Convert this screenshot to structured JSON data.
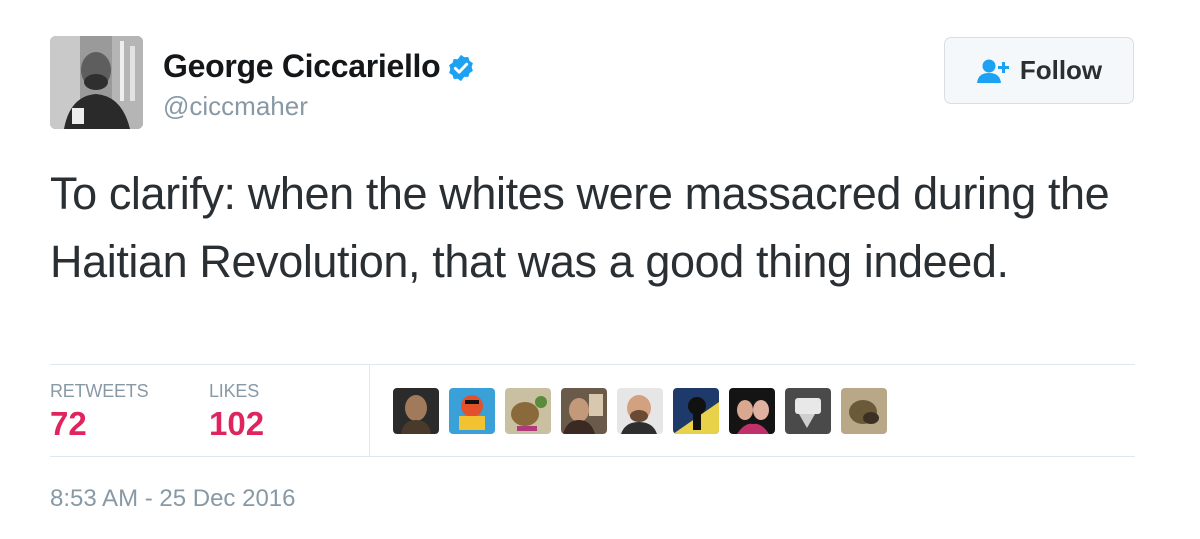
{
  "author": {
    "name": "George Ciccariello",
    "handle": "@ciccmaher",
    "verified": true
  },
  "follow_button": {
    "label": "Follow",
    "icon": "follow-person-plus-icon"
  },
  "tweet": {
    "text": "To clarify: when the whites were massacred during the Haitian Revolution, that was a good thing indeed."
  },
  "stats": {
    "retweets_label": "RETWEETS",
    "retweets_count": "72",
    "likes_label": "LIKES",
    "likes_count": "102"
  },
  "liker_avatars_count": 9,
  "timestamp": "8:53 AM - 25 Dec 2016",
  "colors": {
    "accent": "#1da1f2",
    "count_red": "#e0245e",
    "muted": "#8899a6",
    "text": "#292f33"
  }
}
